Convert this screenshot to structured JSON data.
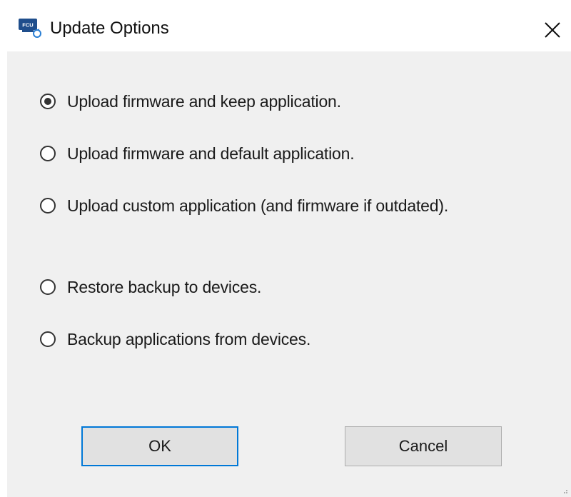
{
  "window": {
    "title": "Update Options",
    "app_icon": "fcu-app-icon",
    "app_icon_text": "FCU",
    "close_icon": "close-icon"
  },
  "options": [
    {
      "label": "Upload firmware and keep application.",
      "selected": true
    },
    {
      "label": "Upload firmware and default application.",
      "selected": false
    },
    {
      "label": "Upload custom application (and firmware if outdated).",
      "selected": false
    },
    {
      "label": "Restore backup to devices.",
      "selected": false
    },
    {
      "label": "Backup applications from devices.",
      "selected": false
    }
  ],
  "buttons": {
    "ok_label": "OK",
    "cancel_label": "Cancel"
  },
  "colors": {
    "accent": "#0078d7",
    "client_background": "#f0f0f0",
    "icon_blue": "#1f4e8c"
  }
}
